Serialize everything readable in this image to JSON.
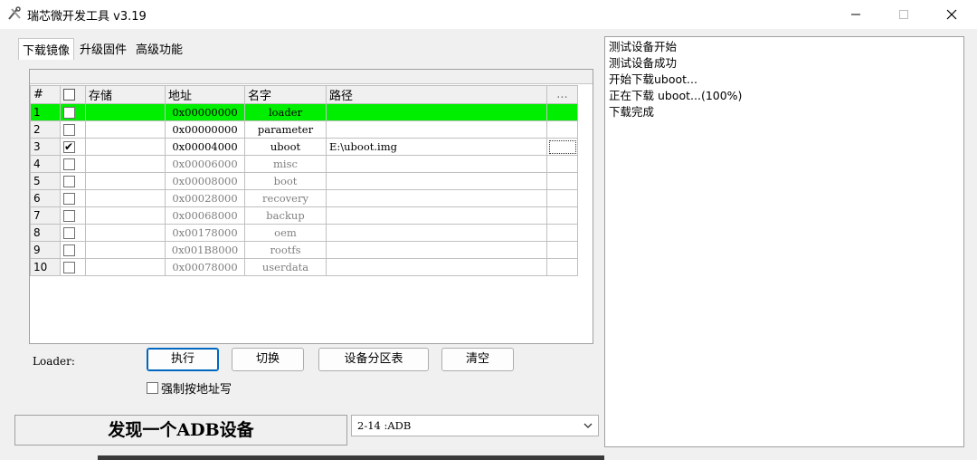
{
  "window": {
    "title": "瑞芯微开发工具 v3.19"
  },
  "tabs": [
    {
      "label": "下载镜像",
      "active": true
    },
    {
      "label": "升级固件",
      "active": false
    },
    {
      "label": "高级功能",
      "active": false
    }
  ],
  "table": {
    "headers": {
      "index": "#",
      "store": "存储",
      "address": "地址",
      "name": "名字",
      "path": "路径",
      "more": "..."
    },
    "rows": [
      {
        "index": "1",
        "checked": false,
        "store": "",
        "address": "0x00000000",
        "name": "loader",
        "path": "",
        "selected": true,
        "disabled": false
      },
      {
        "index": "2",
        "checked": false,
        "store": "",
        "address": "0x00000000",
        "name": "parameter",
        "path": "",
        "selected": false,
        "disabled": false
      },
      {
        "index": "3",
        "checked": true,
        "store": "",
        "address": "0x00004000",
        "name": "uboot",
        "path": "E:\\uboot.img",
        "selected": false,
        "disabled": false
      },
      {
        "index": "4",
        "checked": false,
        "store": "",
        "address": "0x00006000",
        "name": "misc",
        "path": "",
        "selected": false,
        "disabled": true
      },
      {
        "index": "5",
        "checked": false,
        "store": "",
        "address": "0x00008000",
        "name": "boot",
        "path": "",
        "selected": false,
        "disabled": true
      },
      {
        "index": "6",
        "checked": false,
        "store": "",
        "address": "0x00028000",
        "name": "recovery",
        "path": "",
        "selected": false,
        "disabled": true
      },
      {
        "index": "7",
        "checked": false,
        "store": "",
        "address": "0x00068000",
        "name": "backup",
        "path": "",
        "selected": false,
        "disabled": true
      },
      {
        "index": "8",
        "checked": false,
        "store": "",
        "address": "0x00178000",
        "name": "oem",
        "path": "",
        "selected": false,
        "disabled": true
      },
      {
        "index": "9",
        "checked": false,
        "store": "",
        "address": "0x001B8000",
        "name": "rootfs",
        "path": "",
        "selected": false,
        "disabled": true
      },
      {
        "index": "10",
        "checked": false,
        "store": "",
        "address": "0x00078000",
        "name": "userdata",
        "path": "",
        "selected": false,
        "disabled": true
      }
    ]
  },
  "controls": {
    "loader_label": "Loader:",
    "run": "执行",
    "switch": "切换",
    "partition_table": "设备分区表",
    "clear": "清空",
    "force_write": "强制按地址写"
  },
  "status": {
    "text": "发现一个ADB设备"
  },
  "device_select": {
    "value": "2-14 :ADB"
  },
  "log": {
    "lines": [
      "测试设备开始",
      "测试设备成功",
      "开始下载uboot...",
      "正在下载 uboot...(100%)",
      "下载完成"
    ]
  },
  "colors": {
    "selected_row": "#00ee00",
    "default_button_border": "#0067c0"
  }
}
